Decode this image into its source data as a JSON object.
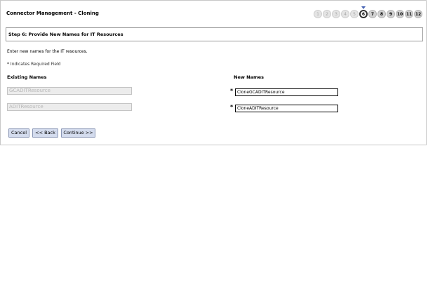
{
  "header": {
    "title": "Connector Management - Cloning"
  },
  "steps": [
    "1",
    "2",
    "3",
    "4",
    "5",
    "6",
    "7",
    "8",
    "9",
    "10",
    "11",
    "12"
  ],
  "current_step": "6",
  "section": {
    "title": "Step 6: Provide New Names for IT Resources"
  },
  "instructions": "Enter new names for the IT resources.",
  "required_note": {
    "star": "*",
    "text": "Indicates Required Field"
  },
  "columns": {
    "existing": "Existing Names",
    "new": "New Names"
  },
  "rows": [
    {
      "existing": "GCADITResource",
      "required": "*",
      "new_value": "CloneGCADITResource"
    },
    {
      "existing": "ADITResource",
      "required": "*",
      "new_value": "CloneADITResource"
    }
  ],
  "buttons": {
    "cancel": "Cancel",
    "back": "<< Back",
    "continue": "Continue >>"
  }
}
